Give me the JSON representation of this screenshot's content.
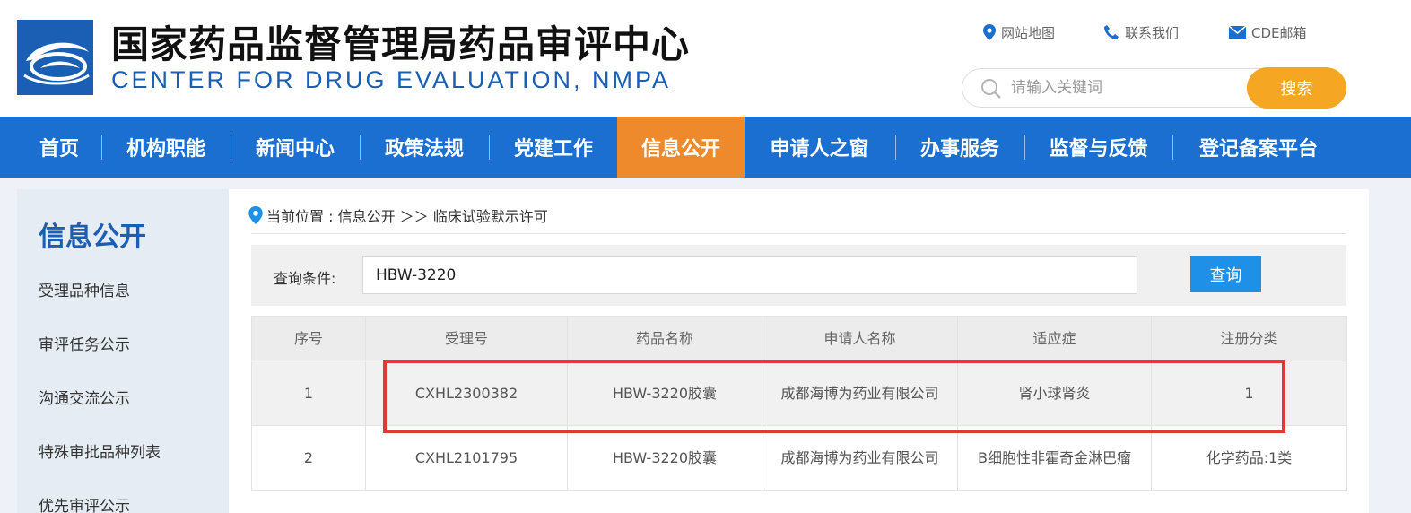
{
  "header": {
    "title": "国家药品监督管理局药品审评中心",
    "subtitle": "CENTER FOR DRUG EVALUATION, NMPA",
    "top_links": [
      "网站地图",
      "联系我们",
      "CDE邮箱"
    ],
    "search_placeholder": "请输入关键词",
    "search_button": "搜索"
  },
  "nav": {
    "items": [
      "首页",
      "机构职能",
      "新闻中心",
      "政策法规",
      "党建工作",
      "信息公开",
      "申请人之窗",
      "办事服务",
      "监督与反馈",
      "登记备案平台"
    ],
    "active": "信息公开"
  },
  "sidebar": {
    "title": "信息公开",
    "items": [
      "受理品种信息",
      "审评任务公示",
      "沟通交流公示",
      "特殊审批品种列表",
      "优先审评公示"
    ]
  },
  "breadcrumb": {
    "text": "当前位置 : 信息公开 ＞＞ 临床试验默示许可"
  },
  "query": {
    "label": "查询条件:",
    "value": "HBW-3220",
    "button": "查询"
  },
  "table": {
    "headers": [
      "序号",
      "受理号",
      "药品名称",
      "申请人名称",
      "适应症",
      "注册分类"
    ],
    "rows": [
      [
        "1",
        "CXHL2300382",
        "HBW-3220胶囊",
        "成都海博为药业有限公司",
        "肾小球肾炎",
        "1"
      ],
      [
        "2",
        "CXHL2101795",
        "HBW-3220胶囊",
        "成都海博为药业有限公司",
        "B细胞性非霍奇金淋巴瘤",
        "化学药品:1类"
      ]
    ]
  },
  "colors": {
    "brand_blue": "#1b6fd0",
    "active_orange": "#ef8a2c",
    "search_orange": "#f5a623",
    "query_blue": "#1e90e8",
    "highlight_red": "#e23838"
  }
}
